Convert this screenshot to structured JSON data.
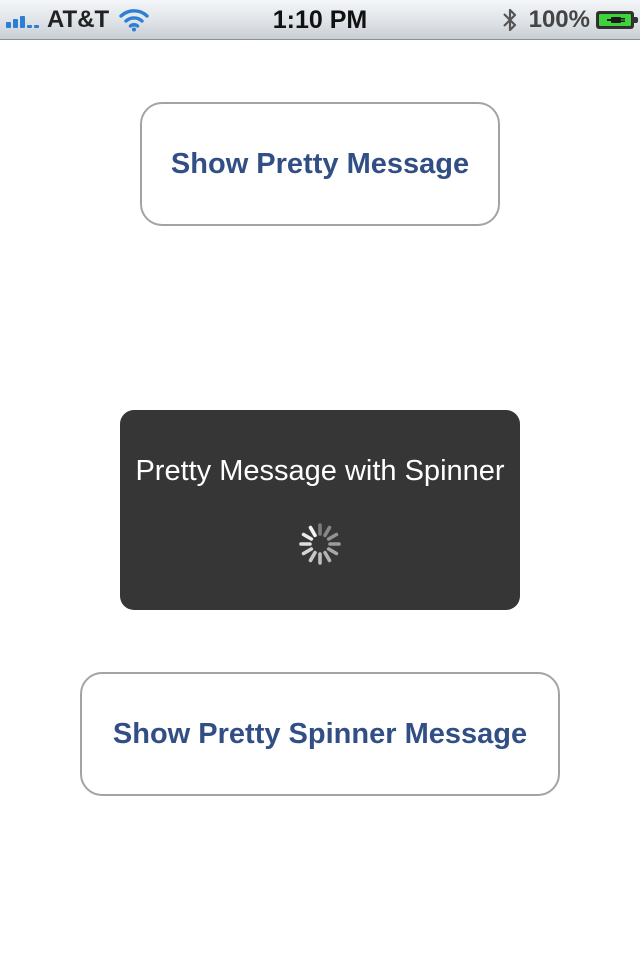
{
  "status_bar": {
    "carrier": "AT&T",
    "time": "1:10 PM",
    "battery_percent": "100%",
    "battery_level": 1.0,
    "signal_bars": 3,
    "icons": [
      "signal-icon",
      "wifi-icon",
      "bluetooth-icon",
      "battery-charging-icon"
    ]
  },
  "main": {
    "show_message_button": "Show Pretty Message",
    "show_spinner_button": "Show Pretty Spinner Message"
  },
  "hud": {
    "message": "Pretty Message with Spinner",
    "spinner_icon": "activity-spinner-icon"
  },
  "colors": {
    "button_text": "#324f85",
    "button_border": "#a3a3a3",
    "hud_background": "#363636",
    "hud_text": "#ffffff",
    "signal_blue": "#2b7fd4",
    "battery_green": "#3fd23c"
  }
}
